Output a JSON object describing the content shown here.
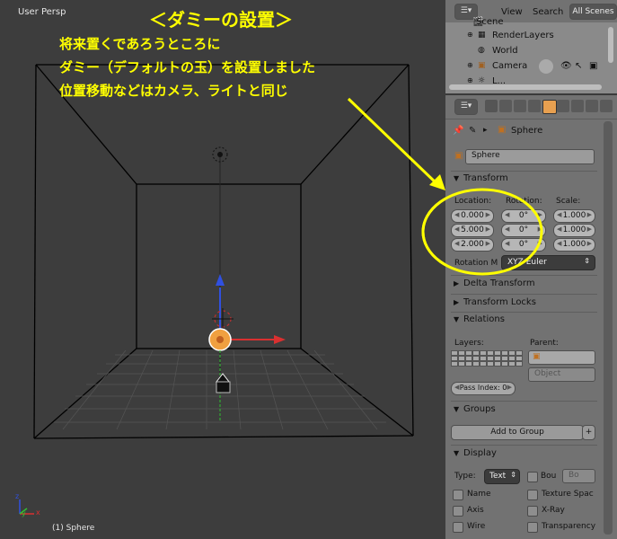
{
  "viewport": {
    "view_label": "User Persp",
    "object_label": "(1) Sphere",
    "axis_labels": {
      "x": "x",
      "y": "y",
      "z": "z"
    }
  },
  "annotation": {
    "title": "＜ダミーの設置＞",
    "line1": "将来置くであろうところに",
    "line2": "ダミー（デフォルトの玉）を設置しました",
    "line3": "位置移動などはカメラ、ライトと同じ",
    "color": "#ffff00"
  },
  "outliner": {
    "menu_view": "View",
    "menu_search": "Search",
    "scene_selector": "All Scenes",
    "items": [
      {
        "label": "Scene",
        "icon": "scene-icon"
      },
      {
        "label": "RenderLayers",
        "icon": "render-layers-icon"
      },
      {
        "label": "World",
        "icon": "world-icon"
      },
      {
        "label": "Camera",
        "icon": "camera-icon"
      },
      {
        "label": "L...",
        "icon": "lamp-icon"
      }
    ]
  },
  "properties": {
    "breadcrumb_object": "Sphere",
    "object_name": "Sphere",
    "transform": {
      "header": "Transform",
      "location_label": "Location:",
      "rotation_label": "Rotation:",
      "scale_label": "Scale:",
      "location": [
        "0.000",
        "5.000",
        "2.000"
      ],
      "rotation": [
        "0°",
        "0°",
        "0°"
      ],
      "scale": [
        "1.000",
        "1.000",
        "1.000"
      ],
      "rotation_mode_label": "Rotation M",
      "rotation_mode_value": "XYZ Euler"
    },
    "delta_transform": "Delta Transform",
    "transform_locks": "Transform Locks",
    "relations": {
      "header": "Relations",
      "layers_label": "Layers:",
      "parent_label": "Parent:",
      "parent_type": "Object",
      "pass_index": "Pass Index: 0"
    },
    "groups": {
      "header": "Groups",
      "add_button": "Add to Group",
      "plus": "+"
    },
    "display": {
      "header": "Display",
      "type_label": "Type:",
      "type_value": "Text",
      "bounds_label": "Bou",
      "bounds_value": "Bo",
      "checks": [
        "Name",
        "Texture Spac",
        "Axis",
        "X-Ray",
        "Wire",
        "Transparency"
      ]
    }
  },
  "colors": {
    "annotation": "#ffff00",
    "x_axis": "#d93030",
    "y_axis": "#30c030",
    "z_axis": "#3050e0",
    "sphere": "#f0a040"
  }
}
